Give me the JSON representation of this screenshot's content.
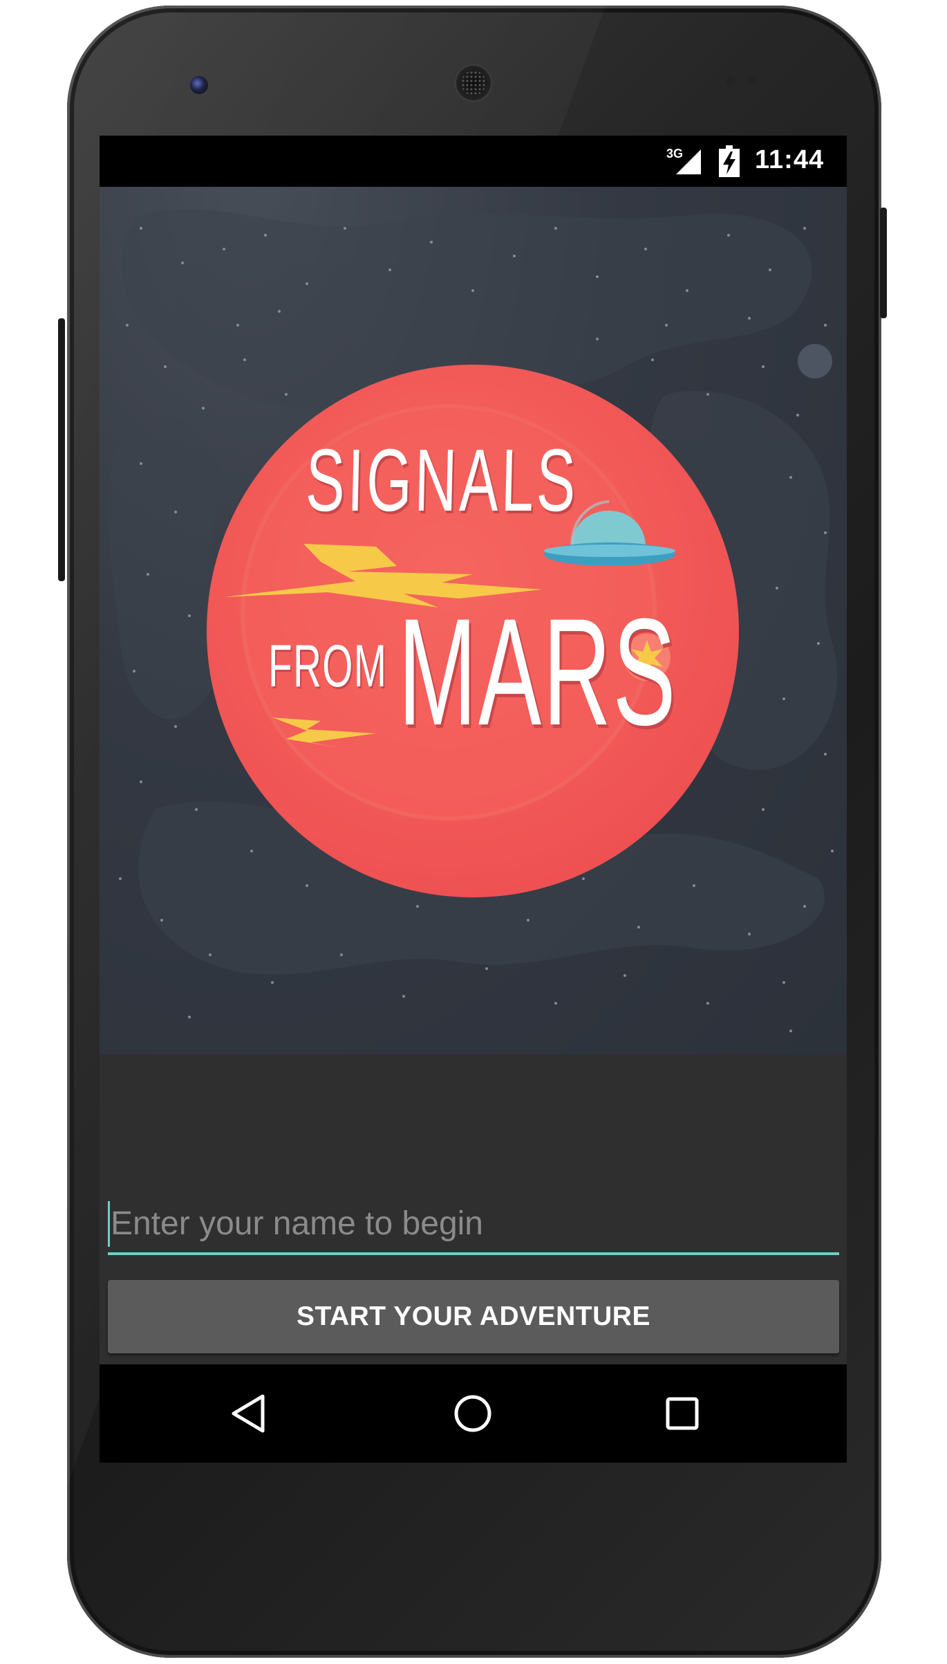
{
  "status_bar": {
    "network": "3G",
    "time": "11:44",
    "icons": [
      "signal-icon",
      "battery-charging-icon"
    ]
  },
  "hero": {
    "logo_line1": "SIGNALS",
    "logo_line2_small": "FROM",
    "logo_line2_large": "MARS",
    "colors": {
      "space": "#2f343d",
      "planet": "#f05656",
      "planet_inner": "#f4655f",
      "lettering": "#ffffff",
      "bolt": "#f7c948",
      "ufo_dome": "#7fcad0",
      "ufo_disc": "#3d9fc0"
    }
  },
  "form": {
    "name_input": {
      "placeholder": "Enter your name to begin",
      "value": ""
    },
    "start_button_label": "START YOUR ADVENTURE"
  },
  "nav_bar": {
    "items": [
      {
        "name": "back",
        "icon": "back-triangle-icon"
      },
      {
        "name": "home",
        "icon": "home-circle-icon"
      },
      {
        "name": "recents",
        "icon": "recents-square-icon"
      }
    ]
  },
  "colors": {
    "accent": "#6fcfc6",
    "form_background": "#2f2f2f",
    "button_background": "#5b5b5b"
  }
}
